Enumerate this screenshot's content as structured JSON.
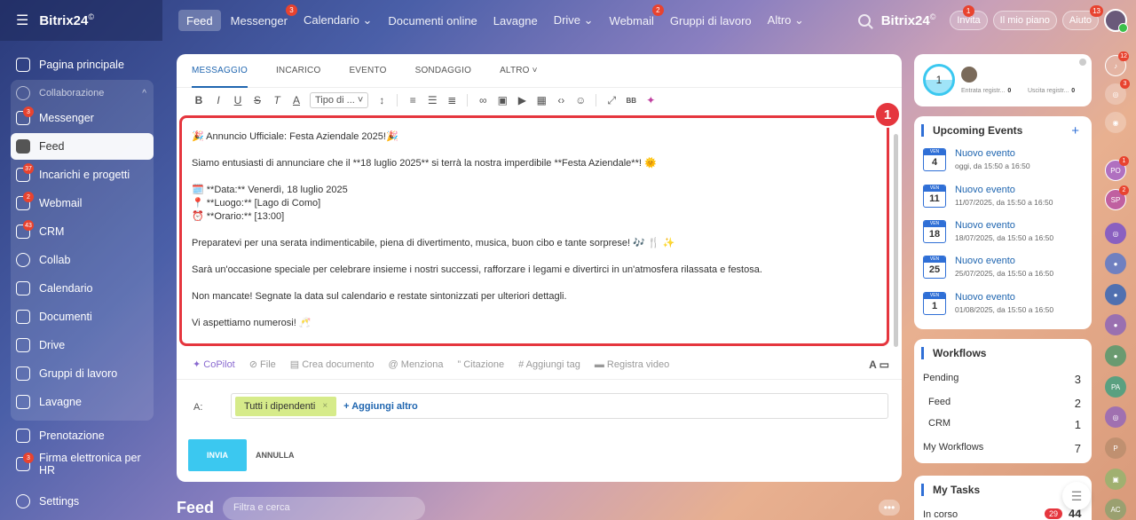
{
  "topbar": {
    "logo": "Bitrix24",
    "logo_mark": "©",
    "nav": [
      {
        "label": "Feed",
        "badge": null,
        "active": true
      },
      {
        "label": "Messenger",
        "badge": "3"
      },
      {
        "label": "Calendario ⌄",
        "badge": null
      },
      {
        "label": "Documenti online",
        "badge": null
      },
      {
        "label": "Lavagne",
        "badge": null
      },
      {
        "label": "Drive ⌄",
        "badge": null
      },
      {
        "label": "Webmail",
        "badge": "2"
      },
      {
        "label": "Gruppi di lavoro",
        "badge": null
      },
      {
        "label": "Altro ⌄",
        "badge": null
      }
    ],
    "brand_right": "Bitrix24",
    "invite": "Invita",
    "invite_badge": "1",
    "plan": "Il mio piano",
    "help": "Aiuto",
    "help_badge": "13"
  },
  "sidebar": {
    "home": "Pagina principale",
    "group_label": "Collaborazione",
    "messenger": "Messenger",
    "messenger_badge": "3",
    "feed": "Feed",
    "tasks": "Incarichi e progetti",
    "tasks_badge": "37",
    "webmail": "Webmail",
    "webmail_badge": "2",
    "crm": "CRM",
    "crm_badge": "43",
    "collab": "Collab",
    "calendar": "Calendario",
    "documents": "Documenti",
    "drive": "Drive",
    "workgroups": "Gruppi di lavoro",
    "boards": "Lavagne",
    "booking": "Prenotazione",
    "esign": "Firma elettronica per HR",
    "esign_badge": "3",
    "settings": "Settings"
  },
  "composer": {
    "tabs": [
      "MESSAGGIO",
      "INCARICO",
      "EVENTO",
      "SONDAGGIO",
      "ALTRO ˅"
    ],
    "style_select": "Tipo di ... ˅",
    "message": {
      "line1": "🎉 Annuncio Ufficiale: Festa Aziendale 2025!🎉",
      "line2": "Siamo entusiasti di annunciare che il **18 luglio 2025** si terrà la nostra imperdibile **Festa Aziendale**! 🌞",
      "line3": "🗓️ **Data:** Venerdì, 18 luglio 2025",
      "line4": "📍 **Luogo:** [Lago di Como]",
      "line5": "⏰ **Orario:** [13:00]",
      "line6": "Preparatevi per una serata indimenticabile, piena di divertimento, musica, buon cibo e tante sorprese! 🎶 🍴 ✨",
      "line7": "Sarà un'occasione speciale per celebrare insieme i nostri successi, rafforzare i legami e divertirci in un'atmosfera rilassata e festosa.",
      "line8": "Non mancate! Segnate la data sul calendario e restate sintonizzati per ulteriori dettagli.",
      "line9": "Vi aspettiamo numerosi! 🥂"
    },
    "callout": "1",
    "attach": {
      "copilot": "CoPilot",
      "file": "File",
      "create_doc": "Crea documento",
      "mention": "Menziona",
      "quote": "Citazione",
      "tag": "Aggiungi tag",
      "record": "Registra video"
    },
    "to_label": "A:",
    "recipient": "Tutti i dipendenti",
    "add_more": "+ Aggiungi altro",
    "send": "INVIA",
    "cancel": "ANNULLA"
  },
  "feed_bar": {
    "title": "Feed",
    "search_placeholder": "Filtra e cerca"
  },
  "stats": {
    "value": "1",
    "incoming_label": "Entrata registr...",
    "incoming": "0",
    "outgoing_label": "Uscita registr...",
    "outgoing": "0"
  },
  "events": {
    "title": "Upcoming Events",
    "items": [
      {
        "day_label": "VEN",
        "day": "4",
        "title": "Nuovo evento",
        "time": "oggi, da 15:50 a 16:50"
      },
      {
        "day_label": "VEN",
        "day": "11",
        "title": "Nuovo evento",
        "time": "11/07/2025, da 15:50 a 16:50"
      },
      {
        "day_label": "VEN",
        "day": "18",
        "title": "Nuovo evento",
        "time": "18/07/2025, da 15:50 a 16:50"
      },
      {
        "day_label": "VEN",
        "day": "25",
        "title": "Nuovo evento",
        "time": "25/07/2025, da 15:50 a 16:50"
      },
      {
        "day_label": "VEN",
        "day": "1",
        "title": "Nuovo evento",
        "time": "01/08/2025, da 15:50 a 16:50"
      }
    ]
  },
  "workflows": {
    "title": "Workflows",
    "rows": [
      {
        "label": "Pending",
        "value": "3"
      },
      {
        "label": "Feed",
        "value": "2"
      },
      {
        "label": "CRM",
        "value": "1"
      },
      {
        "label": "My Workflows",
        "value": "7"
      }
    ]
  },
  "tasks": {
    "title": "My Tasks",
    "in_progress": "In corso",
    "badge": "29",
    "total": "44"
  },
  "rail": {
    "notif_badge": "12",
    "chat_badge": "3",
    "po": "PO",
    "po_badge": "1",
    "sp": "SP",
    "sp_badge": "2",
    "pa": "PA",
    "p": "P",
    "ac": "AC"
  }
}
